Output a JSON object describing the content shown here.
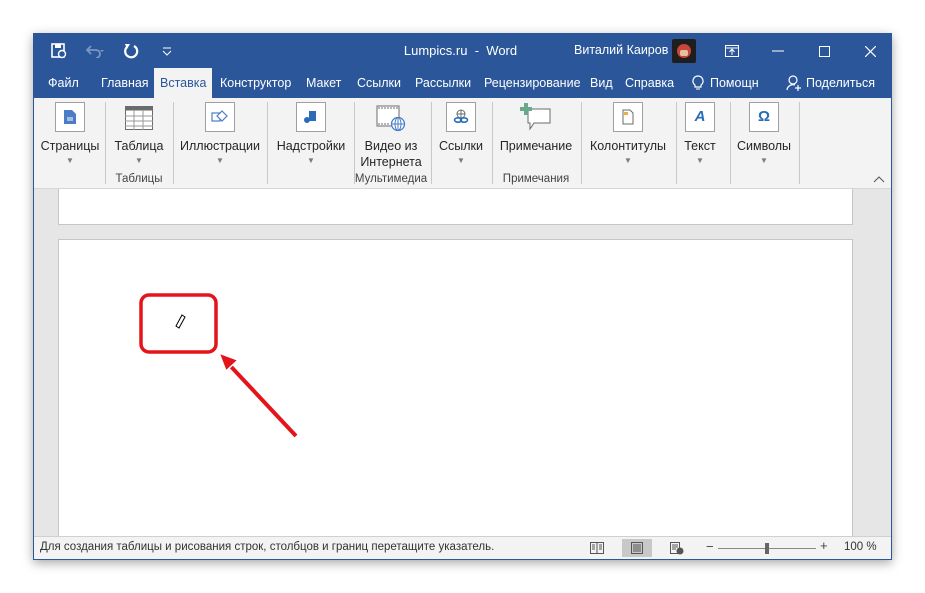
{
  "window": {
    "title_doc": "Lumpics.ru",
    "title_sep": "-",
    "title_app": "Word",
    "user_name": "Виталий Каиров"
  },
  "qat": {
    "icons": [
      "autosave-icon",
      "undo-icon",
      "redo-icon",
      "customize-qat-icon"
    ]
  },
  "tabs": [
    {
      "label": "Файл",
      "active": false
    },
    {
      "label": "Главная",
      "active": false
    },
    {
      "label": "Вставка",
      "active": true
    },
    {
      "label": "Конструктор",
      "active": false
    },
    {
      "label": "Макет",
      "active": false
    },
    {
      "label": "Ссылки",
      "active": false
    },
    {
      "label": "Рассылки",
      "active": false
    },
    {
      "label": "Рецензирование",
      "active": false
    },
    {
      "label": "Вид",
      "active": false
    },
    {
      "label": "Справка",
      "active": false
    }
  ],
  "tell_me": "Помощн",
  "share": "Поделиться",
  "ribbon": {
    "buttons": {
      "pages": "Страницы",
      "table": "Таблица",
      "illustrations": "Иллюстрации",
      "addins": "Надстройки",
      "video_line1": "Видео из",
      "video_line2": "Интернета",
      "links": "Ссылки",
      "comment": "Примечание",
      "header_footer": "Колонтитулы",
      "text": "Текст",
      "symbols": "Символы"
    },
    "groups": {
      "tables": "Таблицы",
      "media": "Мультимедиа",
      "comments": "Примечания"
    }
  },
  "status": {
    "text": "Для создания таблицы и рисования строк, столбцов и границ перетащите указатель.",
    "zoom_minus": "−",
    "zoom_plus": "+",
    "zoom_value": "100 %",
    "zoom_percent": 100,
    "active_view": "print-layout"
  },
  "annotation": {
    "color": "#e3151b",
    "cursor": "pencil-cursor"
  }
}
